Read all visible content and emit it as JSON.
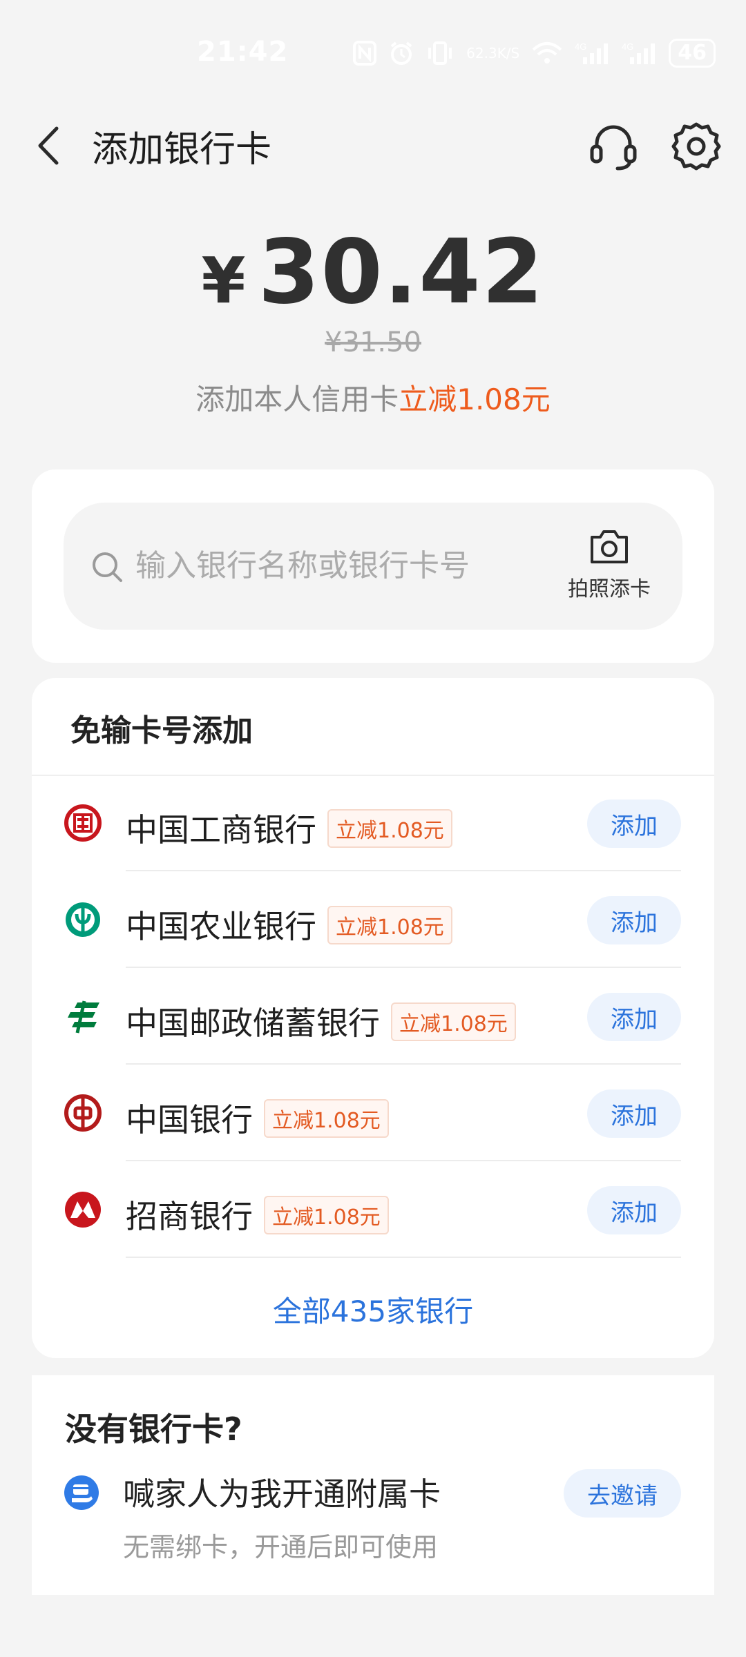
{
  "status_bar": {
    "time": "21:42",
    "net_speed_top": "62.3",
    "net_speed_bottom": "K/S",
    "signal_1_label": "4G",
    "signal_2_label": "4G",
    "battery": "46"
  },
  "header": {
    "title": "添加银行卡",
    "back_icon": "chevron-left-icon",
    "support_icon": "headset-icon",
    "settings_icon": "gear-icon"
  },
  "price": {
    "currency": "¥",
    "amount": "30.42",
    "original": "¥31.50",
    "promo_prefix": "添加本人信用卡",
    "promo_highlight": "立减1.08元"
  },
  "search": {
    "placeholder": "输入银行名称或银行卡号",
    "photo_label": "拍照添卡"
  },
  "quick_add": {
    "section_title": "免输卡号添加",
    "banks": [
      {
        "name": "中国工商银行",
        "tag": "立减1.08元",
        "button": "添加",
        "logo": "icbc-logo-icon",
        "color": "#c8161d"
      },
      {
        "name": "中国农业银行",
        "tag": "立减1.08元",
        "button": "添加",
        "logo": "abc-logo-icon",
        "color": "#009b7a"
      },
      {
        "name": "中国邮政储蓄银行",
        "tag": "立减1.08元",
        "button": "添加",
        "logo": "psbc-logo-icon",
        "color": "#007c3d"
      },
      {
        "name": "中国银行",
        "tag": "立减1.08元",
        "button": "添加",
        "logo": "boc-logo-icon",
        "color": "#b31b1b"
      },
      {
        "name": "招商银行",
        "tag": "立减1.08元",
        "button": "添加",
        "logo": "cmb-logo-icon",
        "color": "#c8161d"
      }
    ],
    "all_banks_link": "全部435家银行"
  },
  "no_card": {
    "title": "没有银行卡?",
    "icon": "family-card-icon",
    "main_text": "喊家人为我开通附属卡",
    "sub_text": "无需绑卡，开通后即可使用",
    "button": "去邀请"
  },
  "colors": {
    "accent_blue": "#2b73dc",
    "promo_orange": "#ee5b1c",
    "background": "#f4f4f4"
  }
}
